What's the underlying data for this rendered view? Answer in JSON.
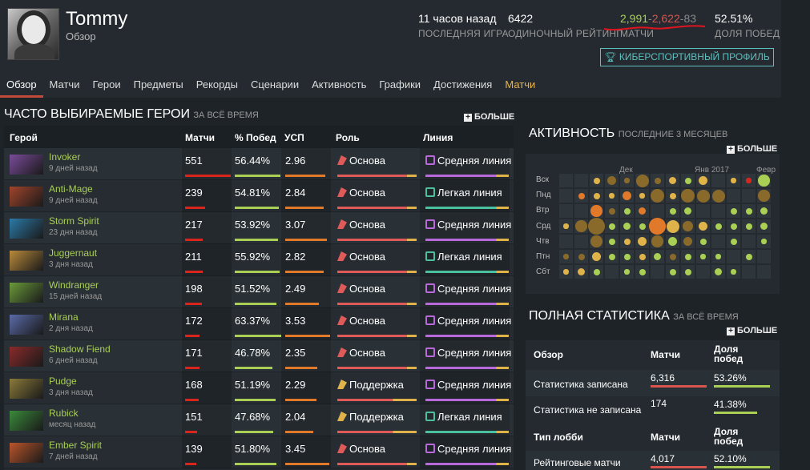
{
  "profile": {
    "username": "Tommy",
    "subtitle": "Обзор",
    "stats": [
      {
        "value": "11 часов назад",
        "label": "ПОСЛЕДНЯЯ ИГРА"
      },
      {
        "value": "6422",
        "label": "ОДИНОЧНЫЙ РЕЙТИНГ"
      },
      {
        "wins": "2,991",
        "losses": "2,622",
        "abandons": "83",
        "sep": "-",
        "label": "МАТЧИ"
      },
      {
        "value": "52.51%",
        "label": "ДОЛЯ ПОБЕД"
      }
    ],
    "esports_button": "КИБЕРСПОРТИВНЫЙ ПРОФИЛЬ"
  },
  "tabs": [
    "Обзор",
    "Матчи",
    "Герои",
    "Предметы",
    "Рекорды",
    "Сценарии",
    "Активность",
    "Графики",
    "Достижения",
    "Матчи"
  ],
  "heroes_section": {
    "title": "ЧАСТО ВЫБИРАЕМЫЕ ГЕРОИ",
    "subtitle": "ЗА ВСЁ ВРЕМЯ",
    "more": "БОЛЬШЕ",
    "columns": [
      "Герой",
      "Матчи",
      "% Побед",
      "УСП",
      "Роль",
      "Линия"
    ],
    "rows": [
      {
        "name": "Invoker",
        "time": "9 дней назад",
        "matches": "551",
        "winrate": "56.44%",
        "kda": "2.96",
        "role": "Основа",
        "lane": "Средняя линия",
        "mfrac": 1.0,
        "wfrac": 0.98,
        "kfrac": 0.9,
        "color": "#7a4b9a"
      },
      {
        "name": "Anti-Mage",
        "time": "9 дней назад",
        "matches": "239",
        "winrate": "54.81%",
        "kda": "2.84",
        "role": "Основа",
        "lane": "Легкая линия",
        "mfrac": 0.43,
        "wfrac": 0.95,
        "kfrac": 0.86,
        "color": "#a0442b"
      },
      {
        "name": "Storm Spirit",
        "time": "23 дня назад",
        "matches": "217",
        "winrate": "53.92%",
        "kda": "3.07",
        "role": "Основа",
        "lane": "Средняя линия",
        "mfrac": 0.39,
        "wfrac": 0.93,
        "kfrac": 0.93,
        "color": "#2b7aa8"
      },
      {
        "name": "Juggernaut",
        "time": "3 дня назад",
        "matches": "211",
        "winrate": "55.92%",
        "kda": "2.82",
        "role": "Основа",
        "lane": "Легкая линия",
        "mfrac": 0.38,
        "wfrac": 0.97,
        "kfrac": 0.85,
        "color": "#b98a3a"
      },
      {
        "name": "Windranger",
        "time": "15 дней назад",
        "matches": "198",
        "winrate": "51.52%",
        "kda": "2.49",
        "role": "Основа",
        "lane": "Средняя линия",
        "mfrac": 0.36,
        "wfrac": 0.89,
        "kfrac": 0.75,
        "color": "#6a9a3a"
      },
      {
        "name": "Mirana",
        "time": "2 дня назад",
        "matches": "172",
        "winrate": "63.37%",
        "kda": "3.53",
        "role": "Основа",
        "lane": "Средняя линия",
        "mfrac": 0.31,
        "wfrac": 1.0,
        "kfrac": 1.0,
        "color": "#5a6aa8"
      },
      {
        "name": "Shadow Fiend",
        "time": "6 дней назад",
        "matches": "171",
        "winrate": "46.78%",
        "kda": "2.35",
        "role": "Основа",
        "lane": "Средняя линия",
        "mfrac": 0.31,
        "wfrac": 0.81,
        "kfrac": 0.71,
        "color": "#8a2a2a"
      },
      {
        "name": "Pudge",
        "time": "3 дня назад",
        "matches": "168",
        "winrate": "51.19%",
        "kda": "2.29",
        "role": "Поддержка",
        "lane": "Средняя линия",
        "mfrac": 0.3,
        "wfrac": 0.88,
        "kfrac": 0.69,
        "color": "#8a7a3a"
      },
      {
        "name": "Rubick",
        "time": "месяц назад",
        "matches": "151",
        "winrate": "47.68%",
        "kda": "2.04",
        "role": "Поддержка",
        "lane": "Легкая линия",
        "mfrac": 0.27,
        "wfrac": 0.82,
        "kfrac": 0.62,
        "color": "#3a8a3a"
      },
      {
        "name": "Ember Spirit",
        "time": "7 дней назад",
        "matches": "139",
        "winrate": "51.80%",
        "kda": "3.45",
        "role": "Основа",
        "lane": "Средняя линия",
        "mfrac": 0.25,
        "wfrac": 0.89,
        "kfrac": 0.98,
        "color": "#b9552a"
      }
    ]
  },
  "activity": {
    "title": "АКТИВНОСТЬ",
    "subtitle": "ПОСЛЕДНИЕ 3 МЕСЯЦЕВ",
    "more": "БОЛЬШЕ",
    "months": [
      "Дек",
      "Янв 2017",
      "Февр"
    ],
    "days": [
      "Вск",
      "Пнд",
      "Втр",
      "Срд",
      "Чтв",
      "Птн",
      "Сбт"
    ]
  },
  "full_stats": {
    "title": "ПОЛНАЯ СТАТИСТИКА",
    "subtitle": "ЗА ВСЁ ВРЕМЯ",
    "more": "БОЛЬШЕ",
    "groups": [
      {
        "head": [
          "Обзор",
          "Матчи",
          "Доля побед"
        ],
        "rows": [
          {
            "label": "Статистика записана",
            "matches": "6,316",
            "winrate": "53.26%",
            "bar": "#d9534f"
          },
          {
            "label": "Статистика не записана",
            "matches": "174",
            "winrate": "41.38%",
            "bar": ""
          }
        ]
      },
      {
        "head": [
          "Тип лобби",
          "Матчи",
          "Доля побед"
        ],
        "rows": [
          {
            "label": "Рейтинговые матчи",
            "matches": "4,017",
            "winrate": "52.10%",
            "bar": "#d9534f"
          }
        ]
      }
    ]
  }
}
